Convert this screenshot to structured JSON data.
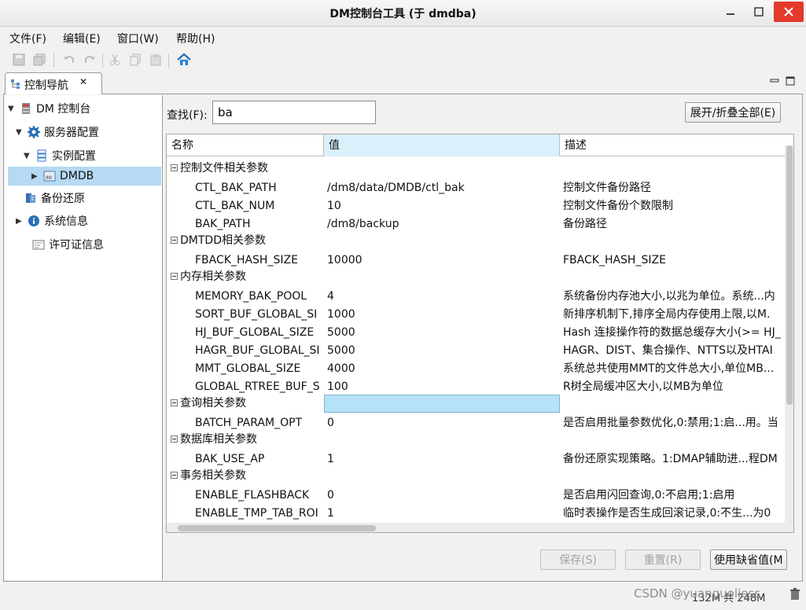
{
  "window": {
    "title": "DM控制台工具 (于 dmdba)"
  },
  "menu": [
    "文件(F)",
    "编辑(E)",
    "窗口(W)",
    "帮助(H)"
  ],
  "view_tab": {
    "label": "控制导航",
    "close": "✕"
  },
  "nav": {
    "items": [
      {
        "label": "DM 控制台",
        "icon": "console-icon",
        "arrow": "▼"
      },
      {
        "label": "服务器配置",
        "icon": "gear-icon",
        "arrow": "▼"
      },
      {
        "label": "实例配置",
        "icon": "instance-icon",
        "arrow": "▼"
      },
      {
        "label": "DMDB",
        "icon": "ini-file-icon",
        "arrow": "▶"
      },
      {
        "label": "备份还原",
        "icon": "backup-icon",
        "arrow": ""
      },
      {
        "label": "系统信息",
        "icon": "info-icon",
        "arrow": "▶"
      },
      {
        "label": "许可证信息",
        "icon": "license-icon",
        "arrow": ""
      }
    ]
  },
  "search": {
    "label": "查找(F):",
    "value": "ba"
  },
  "buttons": {
    "expand_all": "展开/折叠全部(E)",
    "save": "保存(S)",
    "reset": "重置(R)",
    "use_default": "使用缺省值(M"
  },
  "table": {
    "columns": [
      "名称",
      "值",
      "描述"
    ],
    "rows": [
      {
        "type": "group",
        "name": "控制文件相关参数"
      },
      {
        "type": "param",
        "name": "CTL_BAK_PATH",
        "value": "/dm8/data/DMDB/ctl_bak",
        "desc": "控制文件备份路径"
      },
      {
        "type": "param",
        "name": "CTL_BAK_NUM",
        "value": "10",
        "desc": "控制文件备份个数限制"
      },
      {
        "type": "param",
        "name": "BAK_PATH",
        "value": "/dm8/backup",
        "desc": "备份路径"
      },
      {
        "type": "group",
        "name": "DMTDD相关参数"
      },
      {
        "type": "param",
        "name": "FBACK_HASH_SIZE",
        "value": "10000",
        "desc": "FBACK_HASH_SIZE"
      },
      {
        "type": "group",
        "name": "内存相关参数"
      },
      {
        "type": "param",
        "name": "MEMORY_BAK_POOL",
        "value": "4",
        "desc": "系统备份内存池大小,以兆为单位。系统...内"
      },
      {
        "type": "param",
        "name": "SORT_BUF_GLOBAL_SI",
        "value": "1000",
        "desc": "新排序机制下,排序全局内存使用上限,以M."
      },
      {
        "type": "param",
        "name": "HJ_BUF_GLOBAL_SIZE",
        "value": "5000",
        "desc": "Hash 连接操作符的数据总缓存大小(>= HJ_"
      },
      {
        "type": "param",
        "name": "HAGR_BUF_GLOBAL_SI",
        "value": "5000",
        "desc": "HAGR、DIST、集合操作、NTTS以及HTAI"
      },
      {
        "type": "param",
        "name": "MMT_GLOBAL_SIZE",
        "value": "4000",
        "desc": "系统总共使用MMT的文件总大小,单位MB..."
      },
      {
        "type": "param",
        "name": "GLOBAL_RTREE_BUF_S",
        "value": "100",
        "desc": "R树全局缓冲区大小,以MB为单位"
      },
      {
        "type": "group",
        "name": "查询相关参数"
      },
      {
        "type": "param",
        "name": "BATCH_PARAM_OPT",
        "value": "0",
        "desc": "是否启用批量参数优化,0:禁用;1:启...用。当"
      },
      {
        "type": "group",
        "name": "数据库相关参数"
      },
      {
        "type": "param",
        "name": "BAK_USE_AP",
        "value": "1",
        "desc": "备份还原实现策略。1:DMAP辅助进...程DM"
      },
      {
        "type": "group",
        "name": "事务相关参数"
      },
      {
        "type": "param",
        "name": "ENABLE_FLASHBACK",
        "value": "0",
        "desc": "是否启用闪回查询,0:不启用;1:启用"
      },
      {
        "type": "param",
        "name": "ENABLE_TMP_TAB_ROI",
        "value": "1",
        "desc": "临时表操作是否生成回滚记录,0:不生...为0"
      }
    ]
  },
  "status": {
    "memory": "132M 共 248M"
  },
  "watermark": "CSDN @yuanguoliess"
}
